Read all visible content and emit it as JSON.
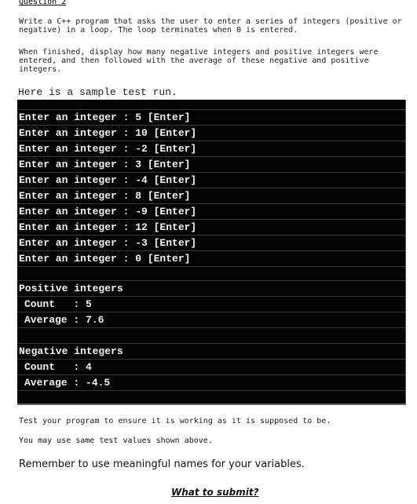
{
  "heading": "Question 2",
  "paragraphs": [
    "Write a C++ program that asks the user to enter a series of integers (positive or negative) in a loop. The loop terminates when 0 is entered.",
    "When finished, display how many negative integers and positive integers were entered, and then followed with the average of these negative and positive integers."
  ],
  "intro": "Here is a sample test run.",
  "terminal": {
    "entries": [
      "Enter an integer : 5 [Enter]",
      "Enter an integer : 10 [Enter]",
      "Enter an integer : -2 [Enter]",
      "Enter an integer : 3 [Enter]",
      "Enter an integer : -4 [Enter]",
      "Enter an integer : 8 [Enter]",
      "Enter an integer : -9 [Enter]",
      "Enter an integer : 12 [Enter]",
      "Enter an integer : -3 [Enter]",
      "Enter an integer : 0 [Enter]"
    ],
    "positive": {
      "title": "Positive integers",
      "count_line": "Count   : 5",
      "average_line": "Average : 7.6"
    },
    "negative": {
      "title": "Negative integers",
      "count_line": "Count   : 4",
      "average_line": "Average : -4.5"
    }
  },
  "footer": {
    "test_note": "Test your program to ensure it is working as it is supposed to be.",
    "values_note": "You may use same test values shown above.",
    "remember": "Remember to use meaningful names for your variables.",
    "what_to_submit": "What to submit?"
  }
}
